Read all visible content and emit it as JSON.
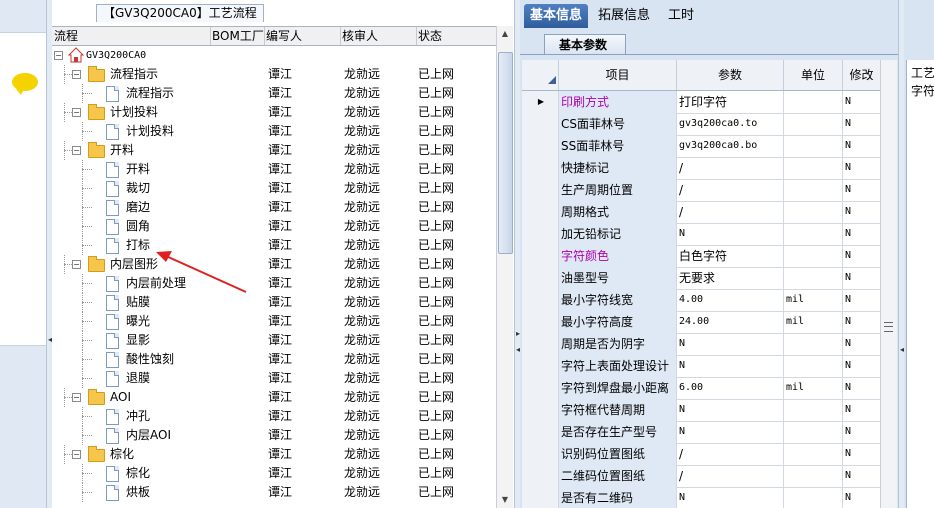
{
  "flow_panel": {
    "title": "【GV3Q200CA0】工艺流程",
    "columns": [
      "流程",
      "BOM工厂",
      "编写人",
      "核审人",
      "状态"
    ],
    "rows": [
      {
        "level": 0,
        "type": "root",
        "label": "GV3Q200CA0",
        "writer": "",
        "reviewer": "",
        "status": ""
      },
      {
        "level": 1,
        "type": "folder",
        "label": "流程指示",
        "writer": "谭江",
        "reviewer": "龙勍远",
        "status": "已上网"
      },
      {
        "level": 2,
        "type": "doc",
        "label": "流程指示",
        "writer": "谭江",
        "reviewer": "龙勍远",
        "status": "已上网"
      },
      {
        "level": 1,
        "type": "folder",
        "label": "计划投料",
        "writer": "谭江",
        "reviewer": "龙勍远",
        "status": "已上网"
      },
      {
        "level": 2,
        "type": "doc",
        "label": "计划投料",
        "writer": "谭江",
        "reviewer": "龙勍远",
        "status": "已上网"
      },
      {
        "level": 1,
        "type": "folder",
        "label": "开料",
        "writer": "谭江",
        "reviewer": "龙勍远",
        "status": "已上网"
      },
      {
        "level": 2,
        "type": "doc",
        "label": "开料",
        "writer": "谭江",
        "reviewer": "龙勍远",
        "status": "已上网"
      },
      {
        "level": 2,
        "type": "doc",
        "label": "裁切",
        "writer": "谭江",
        "reviewer": "龙勍远",
        "status": "已上网"
      },
      {
        "level": 2,
        "type": "doc",
        "label": "磨边",
        "writer": "谭江",
        "reviewer": "龙勍远",
        "status": "已上网"
      },
      {
        "level": 2,
        "type": "doc",
        "label": "圆角",
        "writer": "谭江",
        "reviewer": "龙勍远",
        "status": "已上网"
      },
      {
        "level": 2,
        "type": "doc",
        "label": "打标",
        "writer": "谭江",
        "reviewer": "龙勍远",
        "status": "已上网"
      },
      {
        "level": 1,
        "type": "folder",
        "label": "内层图形",
        "writer": "谭江",
        "reviewer": "龙勍远",
        "status": "已上网"
      },
      {
        "level": 2,
        "type": "doc",
        "label": "内层前处理",
        "writer": "谭江",
        "reviewer": "龙勍远",
        "status": "已上网"
      },
      {
        "level": 2,
        "type": "doc",
        "label": "贴膜",
        "writer": "谭江",
        "reviewer": "龙勍远",
        "status": "已上网"
      },
      {
        "level": 2,
        "type": "doc",
        "label": "曝光",
        "writer": "谭江",
        "reviewer": "龙勍远",
        "status": "已上网"
      },
      {
        "level": 2,
        "type": "doc",
        "label": "显影",
        "writer": "谭江",
        "reviewer": "龙勍远",
        "status": "已上网"
      },
      {
        "level": 2,
        "type": "doc",
        "label": "酸性蚀刻",
        "writer": "谭江",
        "reviewer": "龙勍远",
        "status": "已上网"
      },
      {
        "level": 2,
        "type": "doc",
        "label": "退膜",
        "writer": "谭江",
        "reviewer": "龙勍远",
        "status": "已上网"
      },
      {
        "level": 1,
        "type": "folder",
        "label": "AOI",
        "writer": "谭江",
        "reviewer": "龙勍远",
        "status": "已上网"
      },
      {
        "level": 2,
        "type": "doc",
        "label": "冲孔",
        "writer": "谭江",
        "reviewer": "龙勍远",
        "status": "已上网"
      },
      {
        "level": 2,
        "type": "doc",
        "label": "内层AOI",
        "writer": "谭江",
        "reviewer": "龙勍远",
        "status": "已上网"
      },
      {
        "level": 1,
        "type": "folder",
        "label": "棕化",
        "writer": "谭江",
        "reviewer": "龙勍远",
        "status": "已上网"
      },
      {
        "level": 2,
        "type": "doc",
        "label": "棕化",
        "writer": "谭江",
        "reviewer": "龙勍远",
        "status": "已上网"
      },
      {
        "level": 2,
        "type": "doc",
        "label": "烘板",
        "writer": "谭江",
        "reviewer": "龙勍远",
        "status": "已上网"
      }
    ]
  },
  "right_panel": {
    "tabs": [
      "基本信息",
      "拓展信息",
      "工时"
    ],
    "active_tab": "基本信息",
    "sub_tab": "基本参数",
    "columns": [
      "项目",
      "参数",
      "单位",
      "修改"
    ],
    "rows": [
      {
        "item": "印刷方式",
        "value": "打印字符",
        "unit": "",
        "mod": "N",
        "highlight": true,
        "current": true
      },
      {
        "item": "CS面菲林号",
        "value": "gv3q200ca0.to",
        "unit": "",
        "mod": "N",
        "mono": true
      },
      {
        "item": "SS面菲林号",
        "value": "gv3q200ca0.bo",
        "unit": "",
        "mod": "N",
        "mono": true
      },
      {
        "item": "快捷标记",
        "value": "/",
        "unit": "",
        "mod": "N"
      },
      {
        "item": "生产周期位置",
        "value": "/",
        "unit": "",
        "mod": "N"
      },
      {
        "item": "周期格式",
        "value": "/",
        "unit": "",
        "mod": "N"
      },
      {
        "item": "加无铅标记",
        "value": "N",
        "unit": "",
        "mod": "N",
        "mono": true
      },
      {
        "item": "字符颜色",
        "value": "白色字符",
        "unit": "",
        "mod": "N",
        "highlight": true
      },
      {
        "item": "油墨型号",
        "value": "无要求",
        "unit": "",
        "mod": "N"
      },
      {
        "item": "最小字符线宽",
        "value": "4.00",
        "unit": "mil",
        "mod": "N",
        "mono": true
      },
      {
        "item": "最小字符高度",
        "value": "24.00",
        "unit": "mil",
        "mod": "N",
        "mono": true
      },
      {
        "item": "周期是否为阴字",
        "value": "N",
        "unit": "",
        "mod": "N",
        "mono": true
      },
      {
        "item": "字符上表面处理设计",
        "value": "N",
        "unit": "",
        "mod": "N",
        "mono": true
      },
      {
        "item": "字符到焊盘最小距离",
        "value": "6.00",
        "unit": "mil",
        "mod": "N",
        "mono": true
      },
      {
        "item": "字符框代替周期",
        "value": "N",
        "unit": "",
        "mod": "N",
        "mono": true
      },
      {
        "item": "是否存在生产型号",
        "value": "N",
        "unit": "",
        "mod": "N",
        "mono": true
      },
      {
        "item": "识别码位置图纸",
        "value": "/",
        "unit": "",
        "mod": "N"
      },
      {
        "item": "二维码位置图纸",
        "value": "/",
        "unit": "",
        "mod": "N"
      },
      {
        "item": "是否有二维码",
        "value": "N",
        "unit": "",
        "mod": "N",
        "mono": true
      }
    ]
  },
  "far_right": {
    "line1": "工艺",
    "line2": "字符"
  },
  "colors": {
    "accent": "#2f5d9c",
    "highlight_text": "#b000b0",
    "arrow": "#e02020",
    "folder": "#f6c64a"
  },
  "icons": [
    "chat-bubble-icon",
    "home-icon",
    "folder-icon",
    "document-icon",
    "expander-icon",
    "arrow-annotation"
  ]
}
